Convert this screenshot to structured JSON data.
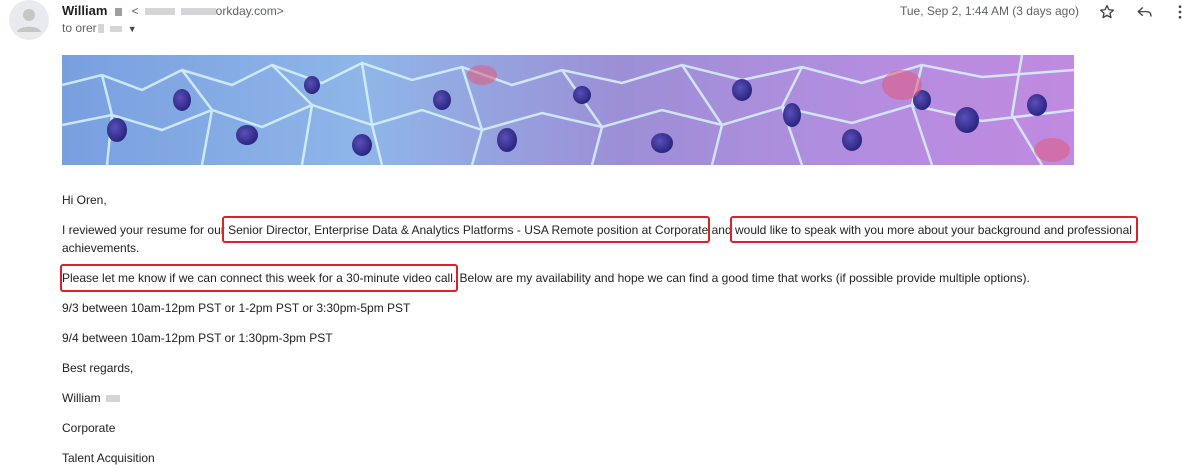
{
  "header": {
    "sender_name": "William",
    "sender_email_suffix": "orkday.com>",
    "sender_email_prefix": "<",
    "recipient_prefix": "to orer",
    "date": "Tue, Sep 2, 1:44 AM (3 days ago)",
    "icons": [
      "person-avatar-icon",
      "star-icon",
      "reply-icon",
      "more-vertical-icon"
    ]
  },
  "body": {
    "greeting": "Hi Oren,",
    "para1_a": "I reviewed your resume for our ",
    "para1_b": "Senior Director, Enterprise Data & Analytics Platforms - USA Remote position at Corporate",
    "para1_c": " and ",
    "para1_d": "would like to speak with you more about your background and professional",
    "para1_line2": "achievements.",
    "para2_a": "Please let me know if we can connect this week for a 30-minute video call.",
    "para2_b": " Below are my availability and hope we can find a good time that works (if possible provide multiple options).",
    "avail1": "9/3 between 10am-12pm PST or 1-2pm PST or 3:30pm-5pm PST",
    "avail2": "9/4 between 10am-12pm PST or 1:30pm-3pm PST",
    "closing": "Best regards,",
    "signature_name": "William",
    "signature_company": "Corporate",
    "signature_dept": "Talent Acquisition"
  },
  "colors": {
    "highlight_box": "#d8232a",
    "redaction": "#9aa0a6"
  }
}
